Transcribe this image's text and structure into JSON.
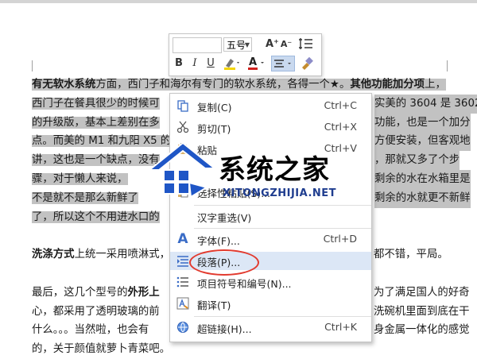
{
  "document": {
    "p1_lines": [
      {
        "bold": "有无软水系统",
        "text": "方面，西门子和海尔有专门的软水系统，各得一个★。",
        "bold2": "其他功能加分项",
        "text2": "上，"
      },
      {
        "text": "西门子在餐具很少的时候可",
        "right": "实美的 3604 是 3602"
      },
      {
        "text": "的升级版，基本上差别在多",
        "right": "功能，也是一个加分"
      },
      {
        "text": "点。而美的 M1 和九阳 X5 的",
        "right": "方便安装，但客观地"
      },
      {
        "text": "讲，这也是一个缺点，没有",
        "right": "，那就又多了个步"
      },
      {
        "text": "骤，对于懒人来说，",
        "right": "剩余的水在水箱里是"
      },
      {
        "text": "不是就不是那么新鲜了",
        "right": "剩余的水就更不新鲜"
      },
      {
        "text": "了，所以这个不用进水口的"
      }
    ],
    "p2": {
      "bold": "洗涤方式",
      "text": "上统一采用喷淋式，",
      "right": "都不错，平局。"
    },
    "p3_lines": [
      {
        "text": "最后，这几个型号的",
        "bold": "外形上",
        "right": "为了满足国人的好奇"
      },
      {
        "text": "心，都采用了透明玻璃的前",
        "right": "洗碗机里面到底在干"
      },
      {
        "text": "什么。。。当然啦，也会有",
        "right": "身金属一体化的感觉"
      },
      {
        "text": "的，关于颜值就萝卜青菜吧。"
      }
    ]
  },
  "mini_toolbar": {
    "font_size": "五号",
    "grow_font": "A⁺",
    "shrink_font": "A⁻",
    "bold": "B",
    "italic": "I",
    "underline": "U",
    "font_color": "A"
  },
  "context_menu": {
    "items": [
      {
        "icon": "copy-icon",
        "label": "复制(C)",
        "shortcut": "Ctrl+C"
      },
      {
        "icon": "cut-icon",
        "label": "剪切(T)",
        "shortcut": "Ctrl+X"
      },
      {
        "icon": "paste-icon",
        "label": "粘贴",
        "shortcut": "Ctrl+V"
      },
      {
        "icon": "paste-special-icon",
        "label": "选择性粘贴(S)...",
        "shortcut": ""
      },
      {
        "icon": "",
        "label": "汉字重选(V)",
        "shortcut": ""
      },
      {
        "icon": "font-icon",
        "label": "字体(F)...",
        "shortcut": "Ctrl+D"
      },
      {
        "icon": "paragraph-icon",
        "label": "段落(P)...",
        "shortcut": ""
      },
      {
        "icon": "bullets-icon",
        "label": "项目符号和编号(N)...",
        "shortcut": ""
      },
      {
        "icon": "translate-icon",
        "label": "翻译(T)",
        "shortcut": ""
      },
      {
        "icon": "hyperlink-icon",
        "label": "超链接(H)...",
        "shortcut": "Ctrl+K"
      }
    ]
  },
  "watermark": {
    "cn": "系统之家",
    "en": "XITONGZHIJIA.NET"
  },
  "colors": {
    "selection": "#c2c2c2",
    "highlight": "#dce7f6",
    "annotation": "#e23a2e",
    "icon_blue": "#3a6cc6"
  }
}
